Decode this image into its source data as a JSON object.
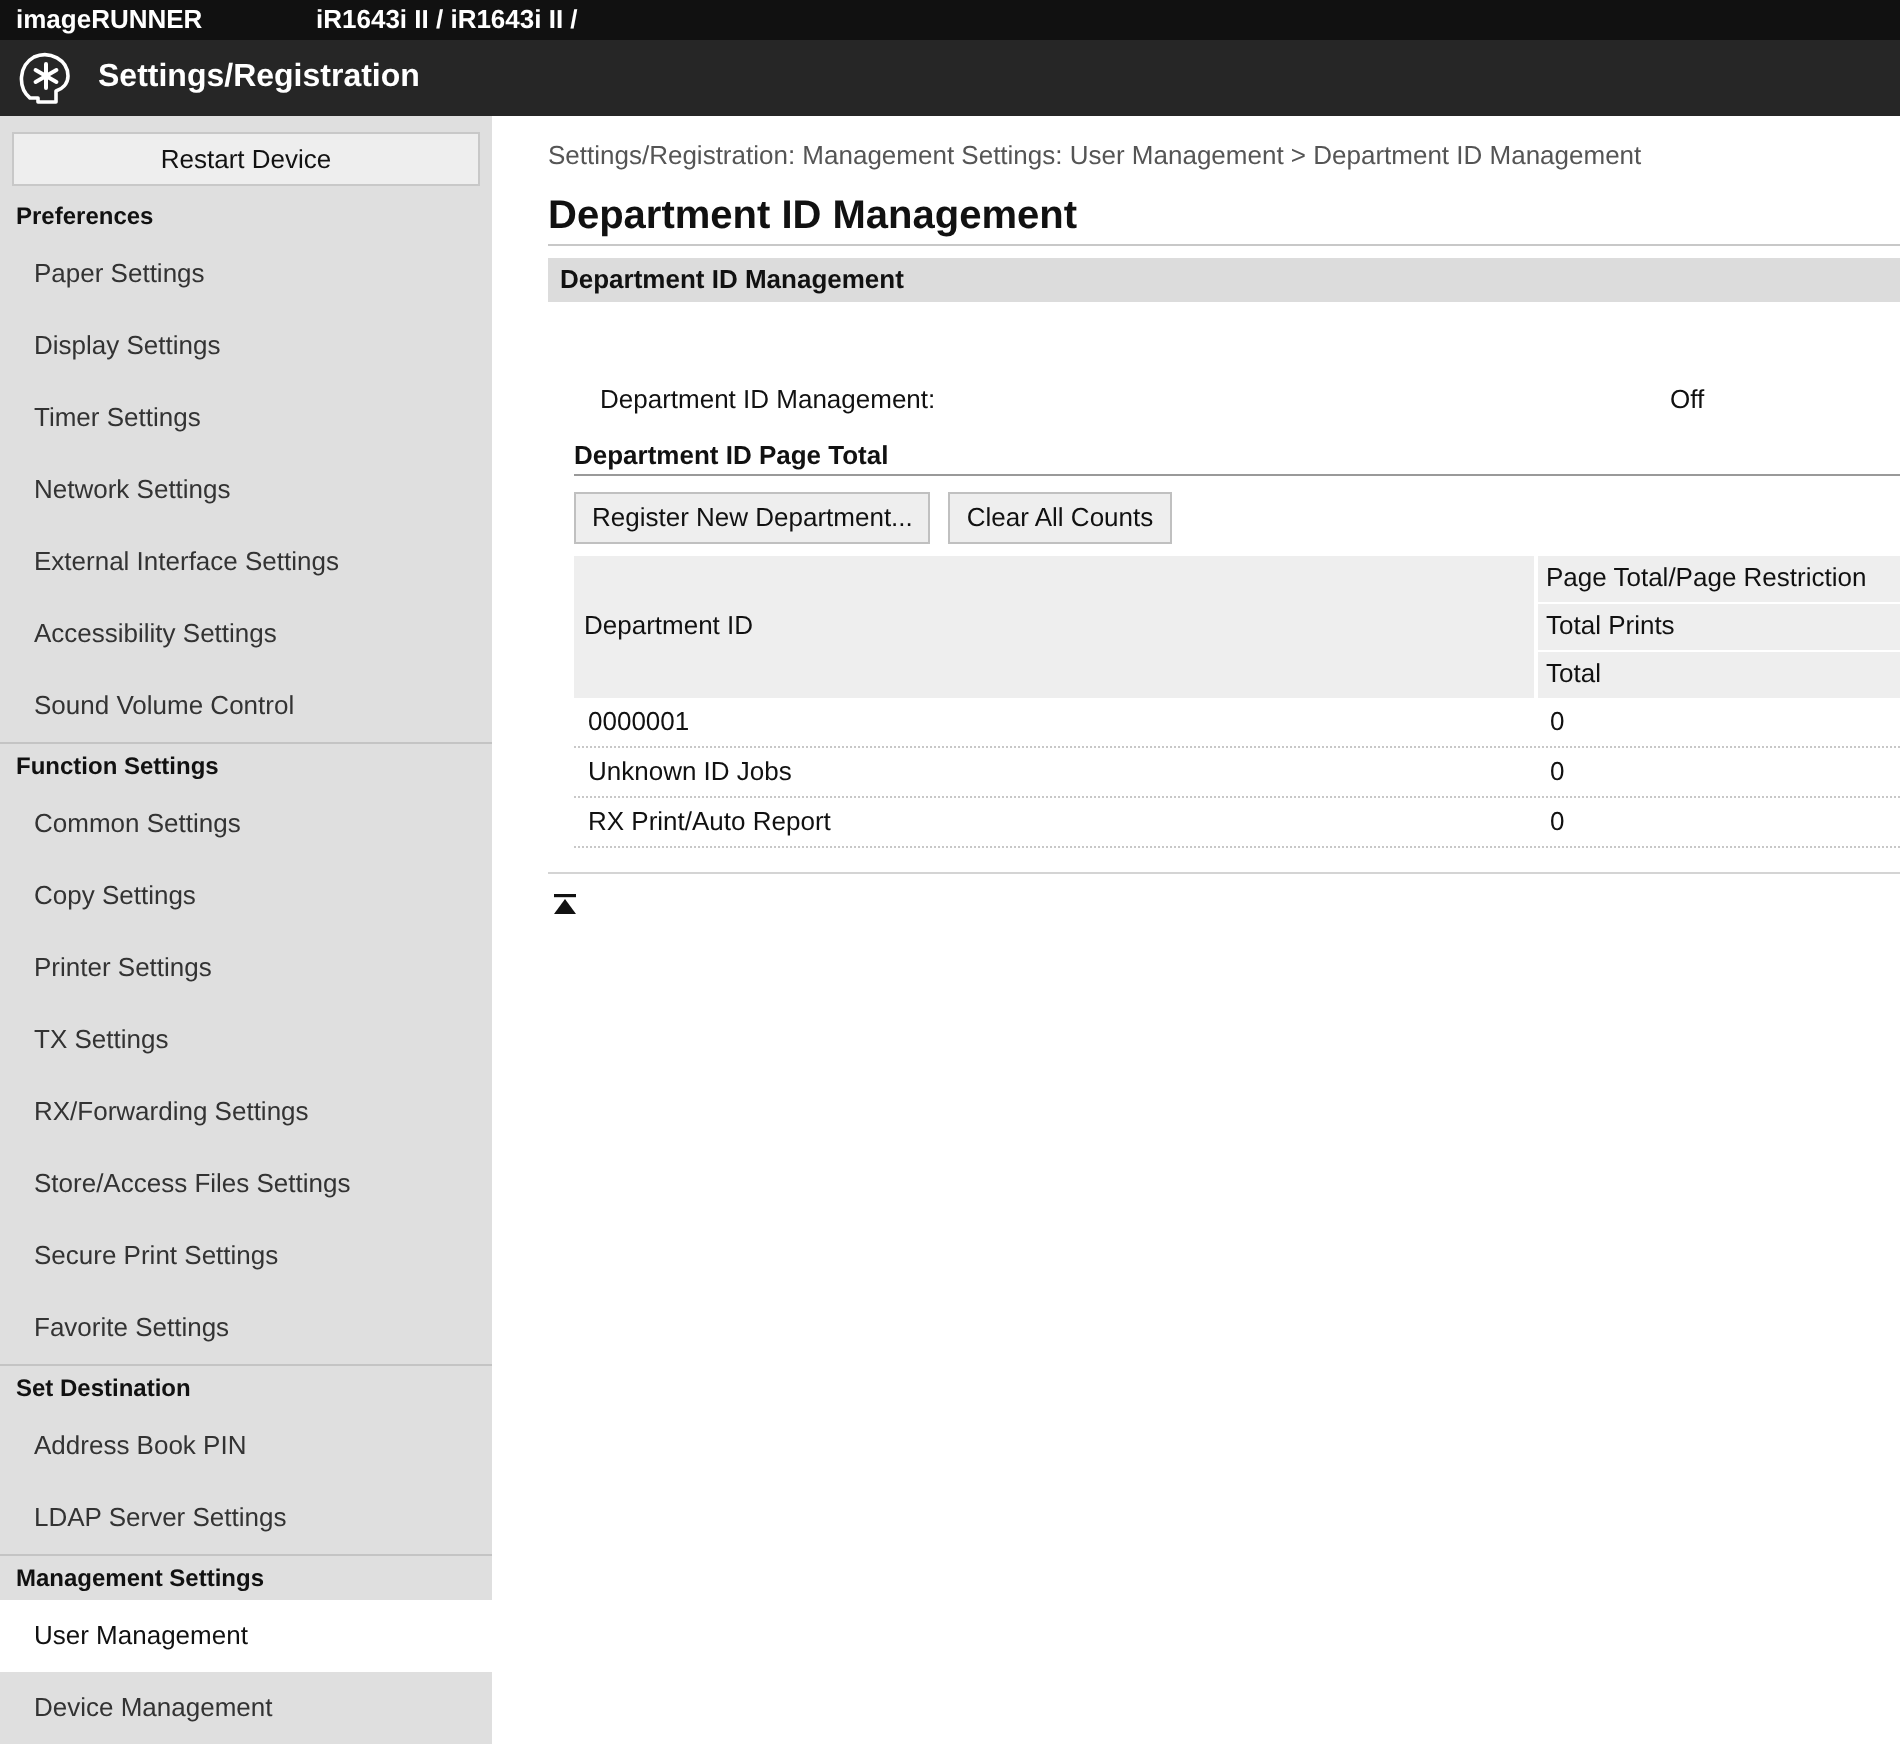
{
  "top_bar": {
    "brand": "imageRUNNER",
    "device": "iR1643i II / iR1643i II /"
  },
  "header": {
    "title": "Settings/Registration"
  },
  "sidebar": {
    "restart_button": "Restart Device",
    "sections": [
      {
        "heading": "Preferences",
        "items": [
          {
            "label": "Paper Settings",
            "selected": false
          },
          {
            "label": "Display Settings",
            "selected": false
          },
          {
            "label": "Timer Settings",
            "selected": false
          },
          {
            "label": "Network Settings",
            "selected": false
          },
          {
            "label": "External Interface Settings",
            "selected": false
          },
          {
            "label": "Accessibility Settings",
            "selected": false
          },
          {
            "label": "Sound Volume Control",
            "selected": false
          }
        ]
      },
      {
        "heading": "Function Settings",
        "items": [
          {
            "label": "Common Settings",
            "selected": false
          },
          {
            "label": "Copy Settings",
            "selected": false
          },
          {
            "label": "Printer Settings",
            "selected": false
          },
          {
            "label": "TX Settings",
            "selected": false
          },
          {
            "label": "RX/Forwarding Settings",
            "selected": false
          },
          {
            "label": "Store/Access Files Settings",
            "selected": false
          },
          {
            "label": "Secure Print Settings",
            "selected": false
          },
          {
            "label": "Favorite Settings",
            "selected": false
          }
        ]
      },
      {
        "heading": "Set Destination",
        "items": [
          {
            "label": "Address Book PIN",
            "selected": false
          },
          {
            "label": "LDAP Server Settings",
            "selected": false
          }
        ]
      },
      {
        "heading": "Management Settings",
        "items": [
          {
            "label": "User Management",
            "selected": true
          },
          {
            "label": "Device Management",
            "selected": false
          }
        ]
      }
    ]
  },
  "main": {
    "breadcrumb": "Settings/Registration: Management Settings: User Management > Department ID Management",
    "title": "Department ID Management",
    "section_title": "Department ID Management",
    "settings": [
      {
        "label": "Department ID Management:",
        "value": "Off"
      }
    ],
    "subsection_title": "Department ID Page Total",
    "buttons": [
      "Register New Department...",
      "Clear All Counts"
    ],
    "table": {
      "id_header": "Department ID",
      "count_headers": [
        "Page Total/Page Restriction",
        "Total Prints",
        "Total"
      ],
      "rows": [
        {
          "department_id": "0000001",
          "total": "0"
        },
        {
          "department_id": "Unknown ID Jobs",
          "total": "0"
        },
        {
          "department_id": "RX Print/Auto Report",
          "total": "0"
        }
      ]
    }
  }
}
